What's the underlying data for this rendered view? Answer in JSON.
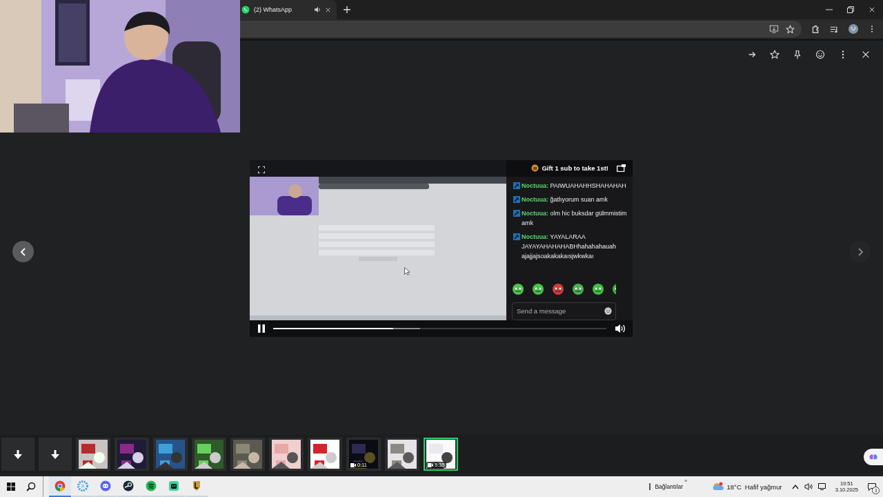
{
  "webcam": {
    "kind": "picture"
  },
  "browser": {
    "tab": {
      "title": "(2) WhatsApp",
      "audio_playing": true
    }
  },
  "viewer": {
    "prev_disabled": false,
    "next_disabled": true
  },
  "player": {
    "paused": false,
    "level": 0.36
  },
  "chat": {
    "banner": "Gift 1 sub to take 1st!",
    "messages": [
      {
        "user": "Noctuua:",
        "text": "PAIWUAHAHHSHAHAHAH"
      },
      {
        "user": "Noctuua:",
        "text": "ğatlıyorum suan amk"
      },
      {
        "user": "Noctuua:",
        "text": "olm hic buksdar gülmmistim amk"
      },
      {
        "user": "Noctuua:",
        "text": "YAYALARAA JAYAYAHAHAHABHhahahahauah ajajjajsoakakakaısjwkwkaı"
      }
    ],
    "input": {
      "placeholder": "Send a message"
    }
  },
  "thumbnails": [
    {
      "kind": "download",
      "selected": false
    },
    {
      "kind": "download",
      "selected": false
    },
    {
      "kind": "picture",
      "selected": false
    },
    {
      "kind": "picture",
      "selected": false
    },
    {
      "kind": "picture",
      "selected": false
    },
    {
      "kind": "picture",
      "selected": false
    },
    {
      "kind": "picture",
      "selected": false
    },
    {
      "kind": "picture",
      "selected": false
    },
    {
      "kind": "picture",
      "selected": false
    },
    {
      "kind": "video",
      "duration": "0:11",
      "selected": false
    },
    {
      "kind": "picture",
      "selected": false
    },
    {
      "kind": "video",
      "duration": "5:35",
      "selected": true
    }
  ],
  "taskbar": {
    "links": "Bağlantılar",
    "chevron": "»",
    "weather": {
      "temp": "18°C",
      "condition": "Hafif yağmur"
    },
    "time": "19:51",
    "date": "3.10.2025",
    "notifications": "3"
  }
}
